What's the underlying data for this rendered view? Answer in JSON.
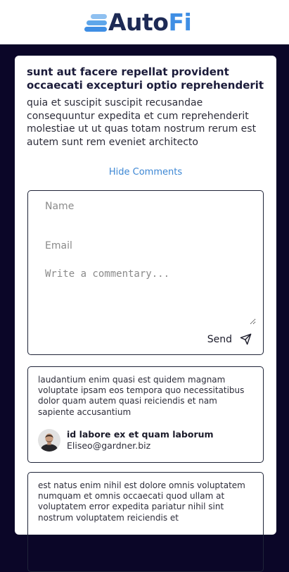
{
  "brand": {
    "name_part1": "Auto",
    "name_part2": "Fi",
    "colors": {
      "navy": "#1d2a55",
      "blue": "#3f8ee4",
      "light_blue": "#8fc0f0"
    }
  },
  "post": {
    "title": "sunt aut facere repellat provident occaecati excepturi optio reprehenderit",
    "body": "quia et suscipit suscipit recusandae consequuntur expedita et cum reprehenderit molestiae ut ut quas totam nostrum rerum est autem sunt rem eveniet architecto",
    "toggle_comments_label": "Hide Comments"
  },
  "comment_form": {
    "name_placeholder": "Name",
    "email_placeholder": "Email",
    "commentary_placeholder": "Write a commentary...",
    "send_label": "Send",
    "send_icon": "send-icon"
  },
  "comments": [
    {
      "body": "laudantium enim quasi est quidem magnam voluptate ipsam eos tempora quo necessitatibus dolor quam autem quasi reiciendis et nam sapiente accusantium",
      "author_name": "id labore ex et quam laborum",
      "author_email": "Eliseo@gardner.biz"
    },
    {
      "body": "est natus enim nihil est dolore omnis voluptatem numquam et omnis occaecati quod ullam at voluptatem error expedita pariatur nihil sint nostrum voluptatem reiciendis et"
    }
  ]
}
